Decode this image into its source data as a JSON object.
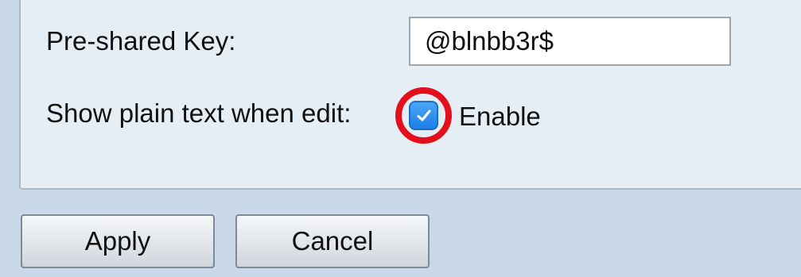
{
  "form": {
    "psk_label": "Pre-shared Key:",
    "psk_value": "@blnbb3r$",
    "plain_text_label": "Show plain text when edit:",
    "plain_text_checked": true,
    "enable_label": "Enable",
    "checkbox_icon": "checkmark-icon"
  },
  "actions": {
    "apply_label": "Apply",
    "cancel_label": "Cancel"
  },
  "colors": {
    "panel_background": "#e6eef5",
    "page_background": "#c9d9ea",
    "checkbox_blue": "#1d7fe6",
    "highlight_red": "#e3101c"
  }
}
